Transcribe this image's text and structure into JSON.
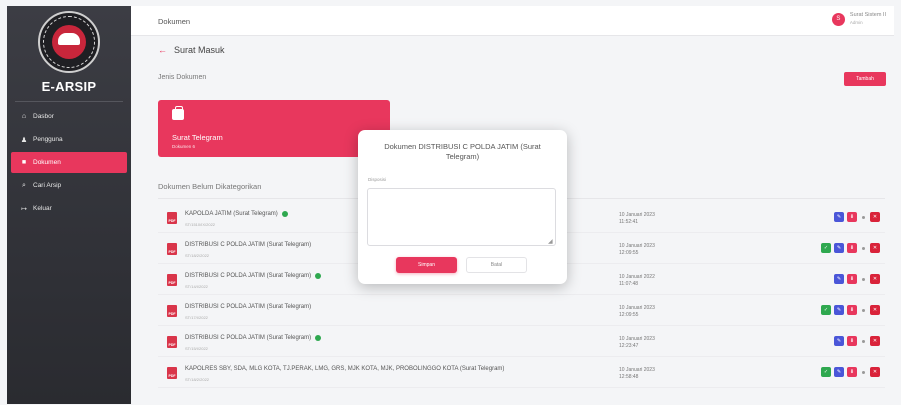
{
  "app": {
    "name": "E-ARSIP"
  },
  "sidebar": {
    "items": [
      {
        "label": "Dasbor",
        "icon": "home-icon",
        "glyph": "⌂"
      },
      {
        "label": "Pengguna",
        "icon": "users-icon",
        "glyph": "♟"
      },
      {
        "label": "Dokumen",
        "icon": "document-icon",
        "glyph": "■"
      },
      {
        "label": "Cari Arsip",
        "icon": "search-icon",
        "glyph": "⌕"
      },
      {
        "label": "Keluar",
        "icon": "logout-icon",
        "glyph": "↦"
      }
    ]
  },
  "topbar": {
    "title": "Dokumen",
    "user_initial": "S",
    "user_name": "Surat Sistem II",
    "user_role": "Admin"
  },
  "main": {
    "back_label": "Surat Masuk",
    "section_label": "Jenis Dokumen",
    "add_button": "Tambah",
    "card": {
      "title": "Surat Telegram",
      "subtitle": "Dokumen 6"
    },
    "uncategorized_label": "Dokumen Belum Dikategorikan"
  },
  "documents": [
    {
      "title": "KAPOLDA JATIM (Surat Telegram)",
      "sub": "ST/1510/IX/2022",
      "date": "10 Januari 2023",
      "time": "11:52:41",
      "checked": true,
      "green_action": false
    },
    {
      "title": "DISTRIBUSI C POLDA JATIM (Surat Telegram)",
      "sub": "ST/18/2/2022",
      "date": "10 Januari 2023",
      "time": "12:09:55",
      "checked": false,
      "green_action": true
    },
    {
      "title": "DISTRIBUSI C POLDA JATIM (Surat Telegram)",
      "sub": "ST/14/I/2022",
      "date": "10 Januari 2022",
      "time": "11:07:48",
      "checked": true,
      "green_action": false
    },
    {
      "title": "DISTRIBUSI C POLDA JATIM (Surat Telegram)",
      "sub": "ST/17/I/2022",
      "date": "10 Januari 2023",
      "time": "12:09:55",
      "checked": false,
      "green_action": true
    },
    {
      "title": "DISTRIBUSI C POLDA JATIM (Surat Telegram)",
      "sub": "ST/15/I/2022",
      "date": "10 Januari 2023",
      "time": "12:23:47",
      "checked": true,
      "green_action": false
    },
    {
      "title": "KAPOLRES SBY, SDA, MLG KOTA, TJ.PERAK, LMG, GRS, MJK KOTA, MJK, PROBOLINGGO KOTA (Surat Telegram)",
      "sub": "ST/18/2/2022",
      "date": "10 Januari 2023",
      "time": "12:58:48",
      "checked": false,
      "green_action": true
    }
  ],
  "modal": {
    "title": "Dokumen DISTRIBUSI C POLDA JATIM (Surat Telegram)",
    "field_label": "Disposisi",
    "field_value": "",
    "save_label": "Simpan",
    "cancel_label": "Batal"
  },
  "colors": {
    "accent": "#e8375d",
    "sidebar": "#2f3036",
    "success": "#2ea84f",
    "edit": "#4a56d8",
    "danger": "#d9233a"
  }
}
